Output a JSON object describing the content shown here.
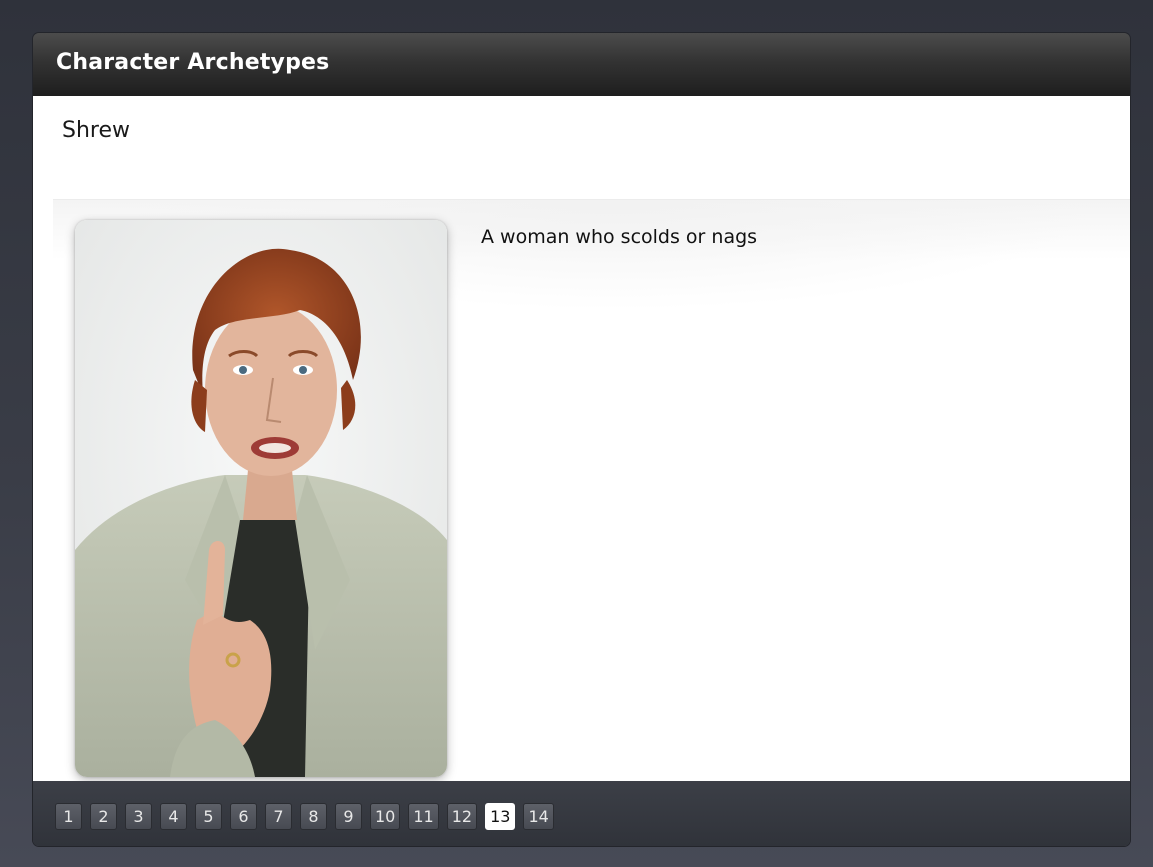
{
  "header": {
    "title": "Character Archetypes"
  },
  "slide": {
    "heading": "Shrew",
    "description": "A woman who scolds or nags",
    "image_subject": "woman pointing finger while scolding"
  },
  "pagination": {
    "pages": [
      "1",
      "2",
      "3",
      "4",
      "5",
      "6",
      "7",
      "8",
      "9",
      "10",
      "11",
      "12",
      "13",
      "14"
    ],
    "current": "13"
  },
  "colors": {
    "title_bar": "#2f2f2f",
    "page_background": "#353842",
    "nav_bar": "#363941",
    "active_page": "#ffffff"
  }
}
